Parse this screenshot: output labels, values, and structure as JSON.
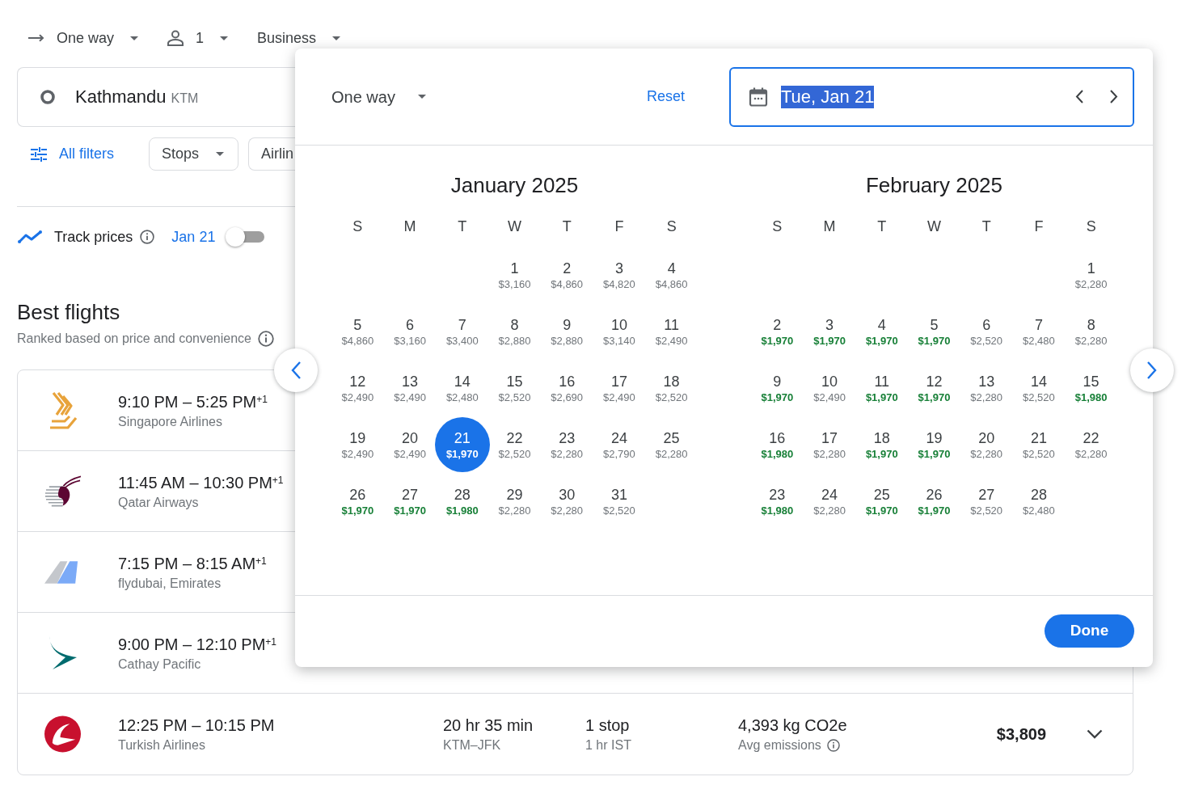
{
  "trip_options": [
    {
      "kind": "trip",
      "label": "One way"
    },
    {
      "kind": "passengers",
      "label": "1"
    },
    {
      "kind": "cabin",
      "label": "Business"
    }
  ],
  "origin": {
    "city": "Kathmandu",
    "code": "KTM"
  },
  "filters": [
    {
      "kind": "all",
      "label": "All filters"
    },
    {
      "kind": "dropdown",
      "label": "Stops"
    },
    {
      "kind": "dropdown",
      "label": "Airlin"
    }
  ],
  "track_prices": {
    "label": "Track prices",
    "date": "Jan 21",
    "on": false
  },
  "best_flights": {
    "title": "Best flights",
    "subtitle": "Ranked based on price and convenience",
    "flights": [
      {
        "kind": "bird",
        "times": "9:10 PM – 5:25 PM$^{+1}$",
        "airline": "Singapore Airlines"
      },
      {
        "kind": "antelope",
        "times": "11:45 AM – 10:30 PM$^{+1}$",
        "airline": "Qatar Airways"
      },
      {
        "kind": "tail_fins",
        "times": "7:15 PM – 8:15 AM$^{+1}$",
        "airline": "flydubai, Emirates"
      },
      {
        "kind": "swoosh",
        "times": "9:00 PM – 12:10 PM$^{+1}$",
        "airline": "Cathay Pacific"
      },
      {
        "kind": "roundel",
        "times": "12:25 PM – 10:15 PM",
        "airline": "Turkish Airlines",
        "duration": "20 hr 35 min",
        "route": "KTM–JFK",
        "stops": "1 stop",
        "layover": "1 hr IST",
        "emissions": "4,393 kg CO2e",
        "emissions_note": "Avg emissions",
        "price": "$3,809"
      }
    ]
  },
  "date_picker": {
    "trip": "One way",
    "reset": "Reset",
    "date": "Tue, Jan 21",
    "done": "Done",
    "months": [
      {
        "title": "January 2025",
        "weekdays": [
          "S",
          "M",
          "T",
          "W",
          "T",
          "F",
          "S"
        ],
        "weeks": [
          [
            {
              "day": "1",
              "price": "$3,160",
              "low": false,
              "selected": false
            },
            {
              "day": "2",
              "price": "$4,860",
              "low": false,
              "selected": false
            },
            {
              "day": "3",
              "price": "$4,820",
              "low": false,
              "selected": false
            },
            {
              "day": "4",
              "price": "$4,860",
              "low": false,
              "selected": false
            }
          ],
          [
            {
              "day": "5",
              "price": "$4,860",
              "low": false,
              "selected": false
            },
            {
              "day": "6",
              "price": "$3,160",
              "low": false,
              "selected": false
            },
            {
              "day": "7",
              "price": "$3,400",
              "low": false,
              "selected": false
            },
            {
              "day": "8",
              "price": "$2,880",
              "low": false,
              "selected": false
            },
            {
              "day": "9",
              "price": "$2,880",
              "low": false,
              "selected": false
            },
            {
              "day": "10",
              "price": "$3,140",
              "low": false,
              "selected": false
            },
            {
              "day": "11",
              "price": "$2,490",
              "low": false,
              "selected": false
            }
          ],
          [
            {
              "day": "12",
              "price": "$2,490",
              "low": false,
              "selected": false
            },
            {
              "day": "13",
              "price": "$2,490",
              "low": false,
              "selected": false
            },
            {
              "day": "14",
              "price": "$2,480",
              "low": false,
              "selected": false
            },
            {
              "day": "15",
              "price": "$2,520",
              "low": false,
              "selected": false
            },
            {
              "day": "16",
              "price": "$2,690",
              "low": false,
              "selected": false
            },
            {
              "day": "17",
              "price": "$2,490",
              "low": false,
              "selected": false
            },
            {
              "day": "18",
              "price": "$2,520",
              "low": false,
              "selected": false
            }
          ],
          [
            {
              "day": "19",
              "price": "$2,490",
              "low": false,
              "selected": false
            },
            {
              "day": "20",
              "price": "$2,490",
              "low": false,
              "selected": false
            },
            {
              "day": "21",
              "price": "$1,970",
              "low": true,
              "selected": true
            },
            {
              "day": "22",
              "price": "$2,520",
              "low": false,
              "selected": false
            },
            {
              "day": "23",
              "price": "$2,280",
              "low": false,
              "selected": false
            },
            {
              "day": "24",
              "price": "$2,790",
              "low": false,
              "selected": false
            },
            {
              "day": "25",
              "price": "$2,280",
              "low": false,
              "selected": false
            }
          ],
          [
            {
              "day": "26",
              "price": "$1,970",
              "low": true,
              "selected": false
            },
            {
              "day": "27",
              "price": "$1,970",
              "low": true,
              "selected": false
            },
            {
              "day": "28",
              "price": "$1,980",
              "low": true,
              "selected": false
            },
            {
              "day": "29",
              "price": "$2,280",
              "low": false,
              "selected": false
            },
            {
              "day": "30",
              "price": "$2,280",
              "low": false,
              "selected": false
            },
            {
              "day": "31",
              "price": "$2,520",
              "low": false,
              "selected": false
            }
          ]
        ]
      },
      {
        "title": "February 2025",
        "weekdays": [
          "S",
          "M",
          "T",
          "W",
          "T",
          "F",
          "S"
        ],
        "weeks": [
          [
            {
              "day": "1",
              "price": "$2,280",
              "low": false,
              "selected": false
            }
          ],
          [
            {
              "day": "2",
              "price": "$1,970",
              "low": true,
              "selected": false
            },
            {
              "day": "3",
              "price": "$1,970",
              "low": true,
              "selected": false
            },
            {
              "day": "4",
              "price": "$1,970",
              "low": true,
              "selected": false
            },
            {
              "day": "5",
              "price": "$1,970",
              "low": true,
              "selected": false
            },
            {
              "day": "6",
              "price": "$2,520",
              "low": false,
              "selected": false
            },
            {
              "day": "7",
              "price": "$2,480",
              "low": false,
              "selected": false
            },
            {
              "day": "8",
              "price": "$2,280",
              "low": false,
              "selected": false
            }
          ],
          [
            {
              "day": "9",
              "price": "$1,970",
              "low": true,
              "selected": false
            },
            {
              "day": "10",
              "price": "$2,490",
              "low": false,
              "selected": false
            },
            {
              "day": "11",
              "price": "$1,970",
              "low": true,
              "selected": false
            },
            {
              "day": "12",
              "price": "$1,970",
              "low": true,
              "selected": false
            },
            {
              "day": "13",
              "price": "$2,280",
              "low": false,
              "selected": false
            },
            {
              "day": "14",
              "price": "$2,520",
              "low": false,
              "selected": false
            },
            {
              "day": "15",
              "price": "$1,980",
              "low": true,
              "selected": false
            }
          ],
          [
            {
              "day": "16",
              "price": "$1,980",
              "low": true,
              "selected": false
            },
            {
              "day": "17",
              "price": "$2,280",
              "low": false,
              "selected": false
            },
            {
              "day": "18",
              "price": "$1,970",
              "low": true,
              "selected": false
            },
            {
              "day": "19",
              "price": "$1,970",
              "low": true,
              "selected": false
            },
            {
              "day": "20",
              "price": "$2,280",
              "low": false,
              "selected": false
            },
            {
              "day": "21",
              "price": "$2,520",
              "low": false,
              "selected": false
            },
            {
              "day": "22",
              "price": "$2,280",
              "low": false,
              "selected": false
            }
          ],
          [
            {
              "day": "23",
              "price": "$1,980",
              "low": true,
              "selected": false
            },
            {
              "day": "24",
              "price": "$2,280",
              "low": false,
              "selected": false
            },
            {
              "day": "25",
              "price": "$1,970",
              "low": true,
              "selected": false
            },
            {
              "day": "26",
              "price": "$1,970",
              "low": true,
              "selected": false
            },
            {
              "day": "27",
              "price": "$2,520",
              "low": false,
              "selected": false
            },
            {
              "day": "28",
              "price": "$2,480",
              "low": false,
              "selected": false
            }
          ]
        ]
      }
    ]
  }
}
